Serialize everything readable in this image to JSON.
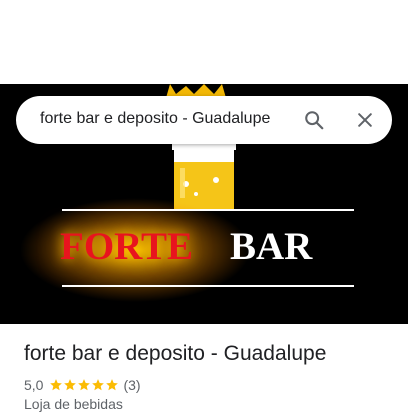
{
  "search": {
    "query": "forte bar e deposito - Guadalupe",
    "search_icon": "search-icon",
    "close_icon": "close-icon"
  },
  "hero": {
    "logo_text_1": "FORTE",
    "logo_text_2": "BAR",
    "colors": {
      "background": "#000000",
      "forte": "#e8141e",
      "glow": "#ffbe00",
      "crown": "#f2b705",
      "beer": "#f5c518"
    }
  },
  "place": {
    "title": "forte bar e deposito - Guadalupe",
    "rating": "5,0",
    "stars_filled": 5,
    "review_count": "(3)",
    "category": "Loja de bebidas",
    "star_color": "#fbbc04"
  }
}
